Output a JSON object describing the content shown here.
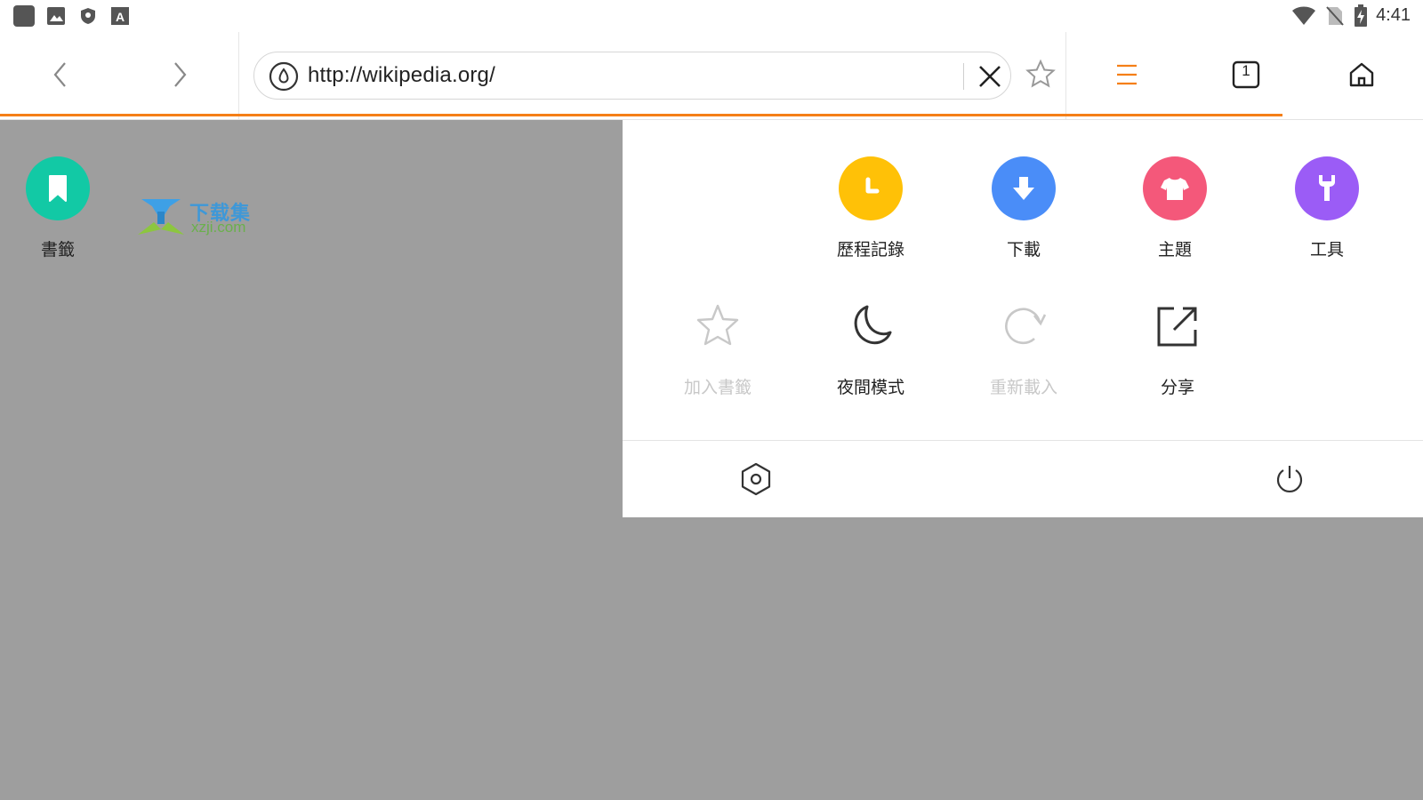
{
  "status_bar": {
    "time": "4:41",
    "left_icons": [
      "app-square-icon",
      "image-icon",
      "shield-icon",
      "font-icon"
    ],
    "right_icons": [
      "wifi-icon",
      "no-sim-icon",
      "battery-charging-icon"
    ]
  },
  "toolbar": {
    "url": "http://wikipedia.org/",
    "tab_count": "1",
    "accent_color": "#f57f17"
  },
  "watermark": {
    "cn": "下载集",
    "en": "xzji.com"
  },
  "menu": {
    "row1": [
      {
        "label": "書籤",
        "icon": "bookmark-icon",
        "color": "#12c9a5"
      },
      {
        "label": "歷程記錄",
        "icon": "clock-icon",
        "color": "#ffc107"
      },
      {
        "label": "下載",
        "icon": "download-icon",
        "color": "#4a8df8"
      },
      {
        "label": "主題",
        "icon": "tshirt-icon",
        "color": "#f4587a"
      },
      {
        "label": "工具",
        "icon": "wrench-icon",
        "color": "#9b5cf6"
      }
    ],
    "row2": [
      {
        "label": "加入書籤",
        "icon": "star-outline-icon",
        "disabled": true
      },
      {
        "label": "夜間模式",
        "icon": "moon-icon",
        "disabled": false
      },
      {
        "label": "重新載入",
        "icon": "reload-icon",
        "disabled": true
      },
      {
        "label": "分享",
        "icon": "share-icon",
        "disabled": false
      }
    ],
    "bottom": [
      "settings-hexagon-icon",
      "power-icon"
    ]
  }
}
